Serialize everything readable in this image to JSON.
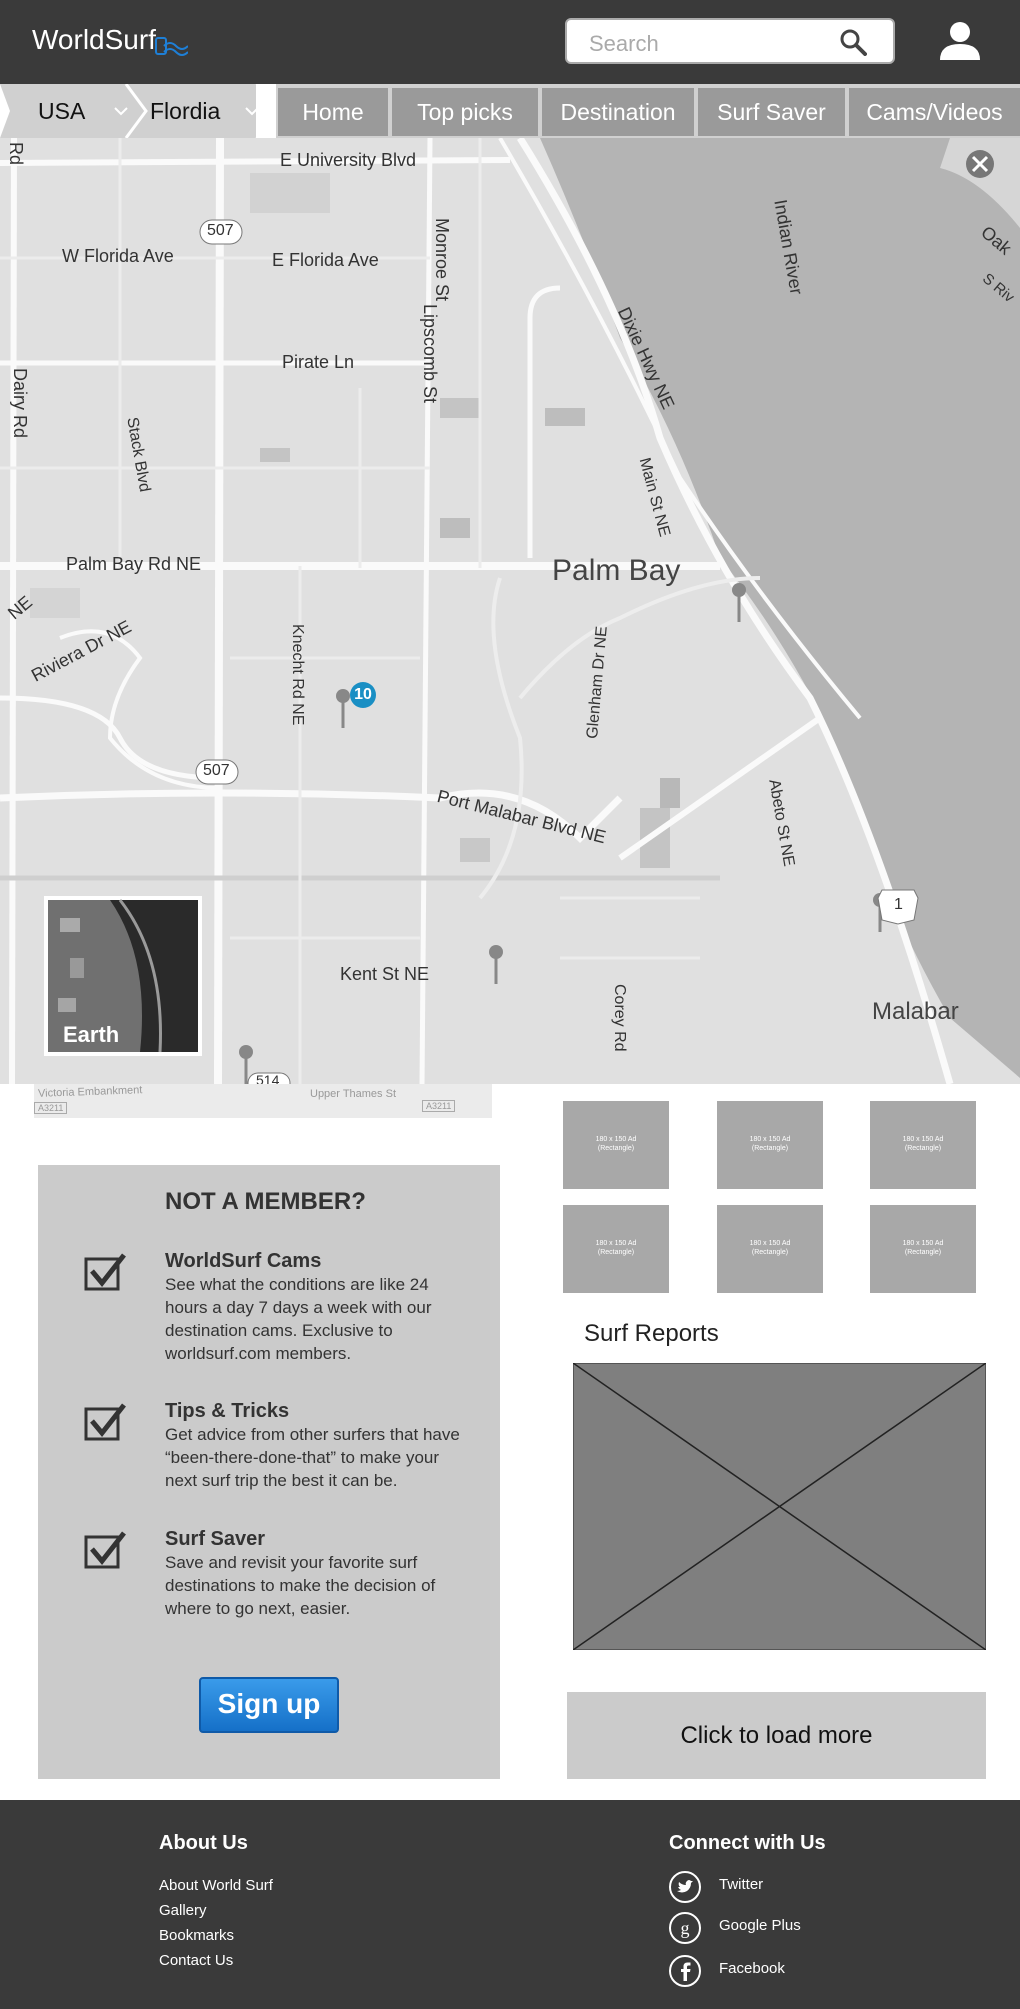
{
  "header": {
    "logo": "WorldSurf",
    "search_placeholder": "Search"
  },
  "breadcrumbs": [
    "USA",
    "Flordia"
  ],
  "nav": [
    "Home",
    "Top picks",
    "Destination",
    "Surf Saver",
    "Cams/Videos"
  ],
  "map": {
    "labels": {
      "e_university": "E University Blvd",
      "w_florida": "W Florida Ave",
      "e_florida": "E Florida Ave",
      "monroe": "Monroe St",
      "lipscomb": "Lipscomb St",
      "pirate": "Pirate Ln",
      "dixie": "Dixie Hwy NE",
      "main": "Main St NE",
      "indian_river": "Indian River",
      "dairy": "Dairy Rd",
      "stack": "Stack Blvd",
      "palm_bay_rd": "Palm Bay Rd NE",
      "riviera": "Riviera Dr NE",
      "knecht": "Knecht Rd NE",
      "glenham": "Glenham Dr NE",
      "palm_bay": "Palm Bay",
      "port_malabar": "Port Malabar Blvd NE",
      "abeto": "Abeto St NE",
      "kent": "Kent St NE",
      "corey": "Corey Rd",
      "malabar": "Malabar",
      "route_507_a": "507",
      "route_507_b": "507",
      "route_1": "1",
      "route_514": "514",
      "oak": "Oak",
      "s_riv": "S Riv",
      "rd": "Rd",
      "ne": "NE",
      "victoria": "Victoria Embankment",
      "upper_thames": "Upper Thames St",
      "a3211_a": "A3211",
      "a3211_b": "A3211"
    },
    "marker_count": "10",
    "earth_label": "Earth"
  },
  "member": {
    "title": "NOT A MEMBER?",
    "features": [
      {
        "title": "WorldSurf Cams",
        "text": "See what the conditions are like 24 hours a day 7 days a week with our destination cams. Exclusive to worldsurf.com members."
      },
      {
        "title": "Tips & Tricks",
        "text": "Get advice from other surfers that have “been-there-done-that” to make your next surf trip the best it can be."
      },
      {
        "title": "Surf Saver",
        "text": "Save and revisit your favorite surf destinations to make the decision of where to go next, easier."
      }
    ],
    "signup": "Sign up"
  },
  "ads": {
    "line1": "180 x 150 Ad",
    "line2": "(Rectangle)"
  },
  "surf_reports": {
    "title": "Surf Reports",
    "load_more": "Click to load more"
  },
  "footer": {
    "about_title": "About Us",
    "about_links": [
      "About World Surf",
      "Gallery",
      "Bookmarks",
      "Contact Us"
    ],
    "connect_title": "Connect with Us",
    "social": [
      "Twitter",
      "Google Plus",
      "Facebook"
    ]
  },
  "colors": {
    "header_bg": "#3a3a3a",
    "nav_bg": "#9a9a9a",
    "accent_blue": "#1e7fd6",
    "marker_blue": "#1a8fc4"
  }
}
